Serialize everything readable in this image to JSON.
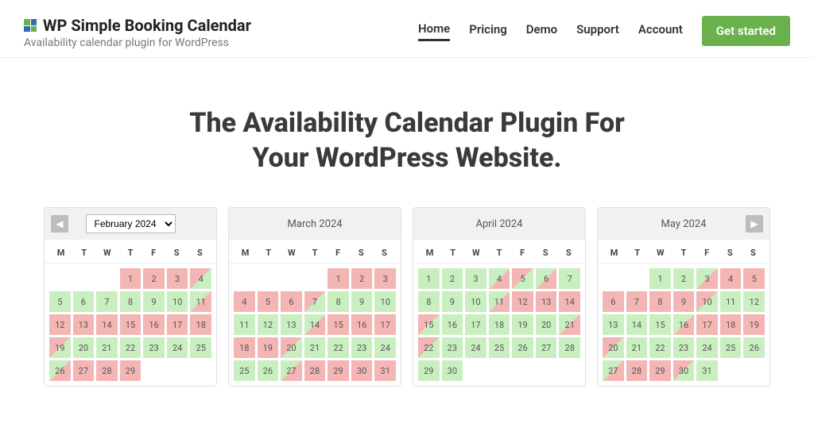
{
  "brand": {
    "title": "WP Simple Booking Calendar",
    "subtitle": "Availability calendar plugin for WordPress"
  },
  "nav": {
    "items": [
      "Home",
      "Pricing",
      "Demo",
      "Support",
      "Account"
    ],
    "active": 0,
    "cta": "Get started"
  },
  "hero": {
    "line1": "The Availability Calendar Plugin For",
    "line2": "Your WordPress Website."
  },
  "dow": [
    "M",
    "T",
    "W",
    "T",
    "F",
    "S",
    "S"
  ],
  "selector_value": "February 2024",
  "calendars": [
    {
      "title": "February 2024",
      "selector": true,
      "arrow_left": true,
      "offset": 3,
      "days": [
        {
          "n": 1,
          "s": "r"
        },
        {
          "n": 2,
          "s": "r"
        },
        {
          "n": 3,
          "s": "r"
        },
        {
          "n": 4,
          "s": "rg"
        },
        {
          "n": 5,
          "s": "g"
        },
        {
          "n": 6,
          "s": "g"
        },
        {
          "n": 7,
          "s": "g"
        },
        {
          "n": 8,
          "s": "g"
        },
        {
          "n": 9,
          "s": "g"
        },
        {
          "n": 10,
          "s": "g"
        },
        {
          "n": 11,
          "s": "gr"
        },
        {
          "n": 12,
          "s": "r"
        },
        {
          "n": 13,
          "s": "r"
        },
        {
          "n": 14,
          "s": "r"
        },
        {
          "n": 15,
          "s": "r"
        },
        {
          "n": 16,
          "s": "r"
        },
        {
          "n": 17,
          "s": "r"
        },
        {
          "n": 18,
          "s": "r"
        },
        {
          "n": 19,
          "s": "rg"
        },
        {
          "n": 20,
          "s": "g"
        },
        {
          "n": 21,
          "s": "g"
        },
        {
          "n": 22,
          "s": "g"
        },
        {
          "n": 23,
          "s": "g"
        },
        {
          "n": 24,
          "s": "g"
        },
        {
          "n": 25,
          "s": "g"
        },
        {
          "n": 26,
          "s": "gr"
        },
        {
          "n": 27,
          "s": "r"
        },
        {
          "n": 28,
          "s": "r"
        },
        {
          "n": 29,
          "s": "r"
        }
      ]
    },
    {
      "title": "March 2024",
      "offset": 4,
      "days": [
        {
          "n": 1,
          "s": "r"
        },
        {
          "n": 2,
          "s": "r"
        },
        {
          "n": 3,
          "s": "r"
        },
        {
          "n": 4,
          "s": "r"
        },
        {
          "n": 5,
          "s": "r"
        },
        {
          "n": 6,
          "s": "r"
        },
        {
          "n": 7,
          "s": "rg"
        },
        {
          "n": 8,
          "s": "g"
        },
        {
          "n": 9,
          "s": "g"
        },
        {
          "n": 10,
          "s": "g"
        },
        {
          "n": 11,
          "s": "g"
        },
        {
          "n": 12,
          "s": "g"
        },
        {
          "n": 13,
          "s": "g"
        },
        {
          "n": 14,
          "s": "gr"
        },
        {
          "n": 15,
          "s": "r"
        },
        {
          "n": 16,
          "s": "r"
        },
        {
          "n": 17,
          "s": "r"
        },
        {
          "n": 18,
          "s": "r"
        },
        {
          "n": 19,
          "s": "r"
        },
        {
          "n": 20,
          "s": "rg"
        },
        {
          "n": 21,
          "s": "g"
        },
        {
          "n": 22,
          "s": "g"
        },
        {
          "n": 23,
          "s": "g"
        },
        {
          "n": 24,
          "s": "g"
        },
        {
          "n": 25,
          "s": "g"
        },
        {
          "n": 26,
          "s": "g"
        },
        {
          "n": 27,
          "s": "gr"
        },
        {
          "n": 28,
          "s": "r"
        },
        {
          "n": 29,
          "s": "r"
        },
        {
          "n": 30,
          "s": "r"
        },
        {
          "n": 31,
          "s": "r"
        }
      ]
    },
    {
      "title": "April 2024",
      "offset": 0,
      "days": [
        {
          "n": 1,
          "s": "g"
        },
        {
          "n": 2,
          "s": "g"
        },
        {
          "n": 3,
          "s": "g"
        },
        {
          "n": 4,
          "s": "gr"
        },
        {
          "n": 5,
          "s": "rg"
        },
        {
          "n": 6,
          "s": "gr"
        },
        {
          "n": 7,
          "s": "g"
        },
        {
          "n": 8,
          "s": "g"
        },
        {
          "n": 9,
          "s": "g"
        },
        {
          "n": 10,
          "s": "g"
        },
        {
          "n": 11,
          "s": "gr"
        },
        {
          "n": 12,
          "s": "r"
        },
        {
          "n": 13,
          "s": "r"
        },
        {
          "n": 14,
          "s": "r"
        },
        {
          "n": 15,
          "s": "rg"
        },
        {
          "n": 16,
          "s": "g"
        },
        {
          "n": 17,
          "s": "g"
        },
        {
          "n": 18,
          "s": "g"
        },
        {
          "n": 19,
          "s": "g"
        },
        {
          "n": 20,
          "s": "g"
        },
        {
          "n": 21,
          "s": "gr"
        },
        {
          "n": 22,
          "s": "rg"
        },
        {
          "n": 23,
          "s": "g"
        },
        {
          "n": 24,
          "s": "g"
        },
        {
          "n": 25,
          "s": "g"
        },
        {
          "n": 26,
          "s": "g"
        },
        {
          "n": 27,
          "s": "g"
        },
        {
          "n": 28,
          "s": "g"
        },
        {
          "n": 29,
          "s": "g"
        },
        {
          "n": 30,
          "s": "g"
        }
      ]
    },
    {
      "title": "May 2024",
      "arrow_right": true,
      "offset": 2,
      "days": [
        {
          "n": 1,
          "s": "g"
        },
        {
          "n": 2,
          "s": "g"
        },
        {
          "n": 3,
          "s": "gr"
        },
        {
          "n": 4,
          "s": "r"
        },
        {
          "n": 5,
          "s": "r"
        },
        {
          "n": 6,
          "s": "r"
        },
        {
          "n": 7,
          "s": "r"
        },
        {
          "n": 8,
          "s": "r"
        },
        {
          "n": 9,
          "s": "r"
        },
        {
          "n": 10,
          "s": "rg"
        },
        {
          "n": 11,
          "s": "g"
        },
        {
          "n": 12,
          "s": "g"
        },
        {
          "n": 13,
          "s": "g"
        },
        {
          "n": 14,
          "s": "g"
        },
        {
          "n": 15,
          "s": "g"
        },
        {
          "n": 16,
          "s": "gr"
        },
        {
          "n": 17,
          "s": "r"
        },
        {
          "n": 18,
          "s": "r"
        },
        {
          "n": 19,
          "s": "r"
        },
        {
          "n": 20,
          "s": "rg"
        },
        {
          "n": 21,
          "s": "g"
        },
        {
          "n": 22,
          "s": "g"
        },
        {
          "n": 23,
          "s": "g"
        },
        {
          "n": 24,
          "s": "g"
        },
        {
          "n": 25,
          "s": "g"
        },
        {
          "n": 26,
          "s": "g"
        },
        {
          "n": 27,
          "s": "gr"
        },
        {
          "n": 28,
          "s": "r"
        },
        {
          "n": 29,
          "s": "r"
        },
        {
          "n": 30,
          "s": "rg"
        },
        {
          "n": 31,
          "s": "g"
        }
      ]
    }
  ]
}
